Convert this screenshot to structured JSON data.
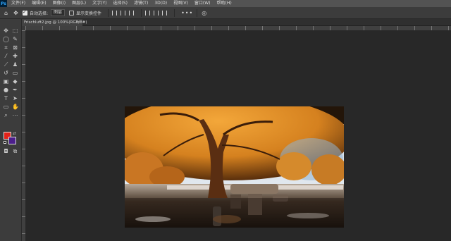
{
  "app": {
    "logo_text": "Ps"
  },
  "menu": [
    "文件(F)",
    "编辑(E)",
    "图像(I)",
    "图层(L)",
    "文字(Y)",
    "选择(S)",
    "滤镜(T)",
    "3D(D)",
    "视图(V)",
    "窗口(W)",
    "帮助(H)"
  ],
  "options_bar": {
    "auto_select_label": "自动选择:",
    "auto_select_value": "图层",
    "show_transform_label": "显示变换控件",
    "more_label": "•••"
  },
  "document": {
    "tab_title": "Frischluft2.jpg @ 100%(RGB/8#)",
    "close_glyph": "×"
  },
  "colors": {
    "foreground": "#e2231a",
    "background": "#4c1f8c",
    "workspace": "#282828"
  },
  "icons": {
    "move": "move-icon",
    "marquee": "marquee-icon",
    "lasso": "lasso-icon",
    "crop": "crop-icon",
    "eyedropper": "eyedropper-icon",
    "brush": "brush-icon",
    "stamp": "clone-stamp-icon",
    "eraser": "eraser-icon",
    "gradient": "gradient-icon",
    "pen": "pen-icon",
    "type": "type-icon",
    "hand": "hand-icon",
    "zoom": "zoom-icon"
  }
}
